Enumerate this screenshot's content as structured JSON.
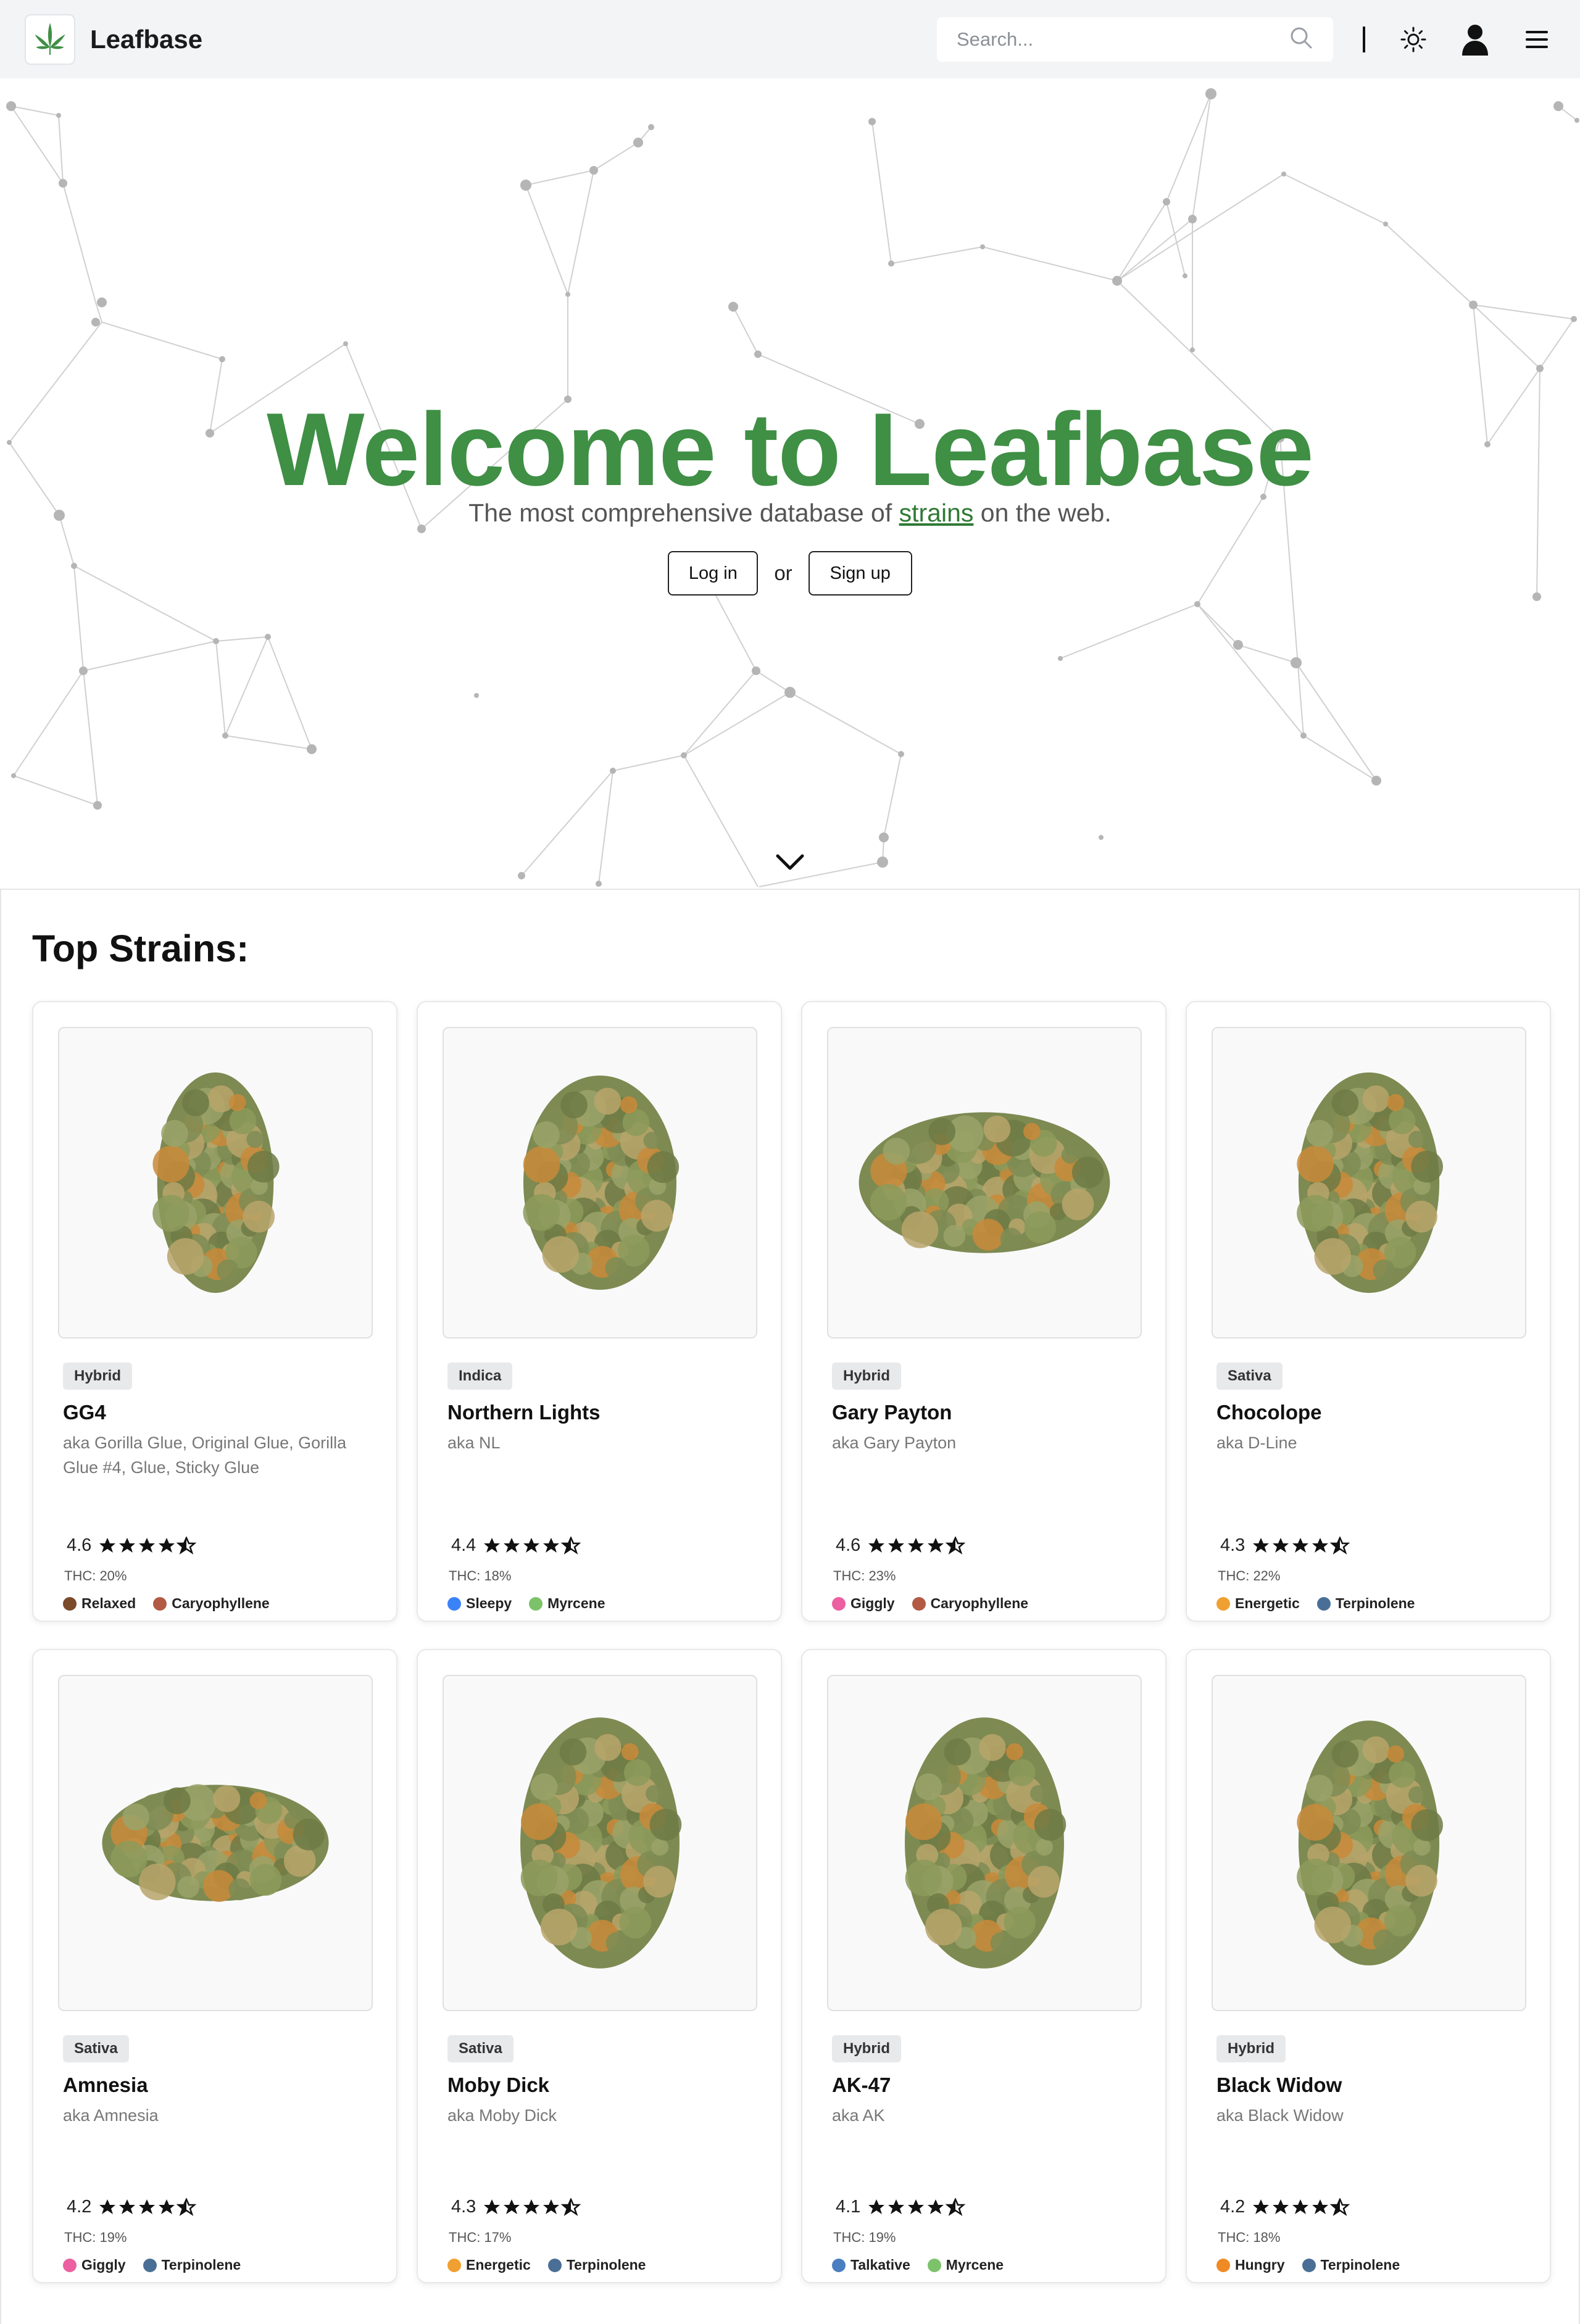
{
  "brand": {
    "name": "Leafbase",
    "accent": "#3f8f45"
  },
  "search": {
    "placeholder": "Search..."
  },
  "nav": {
    "icons": [
      "search-icon",
      "sun-icon",
      "user-icon",
      "menu-icon"
    ]
  },
  "hero": {
    "title": "Welcome to Leafbase",
    "subtitle_before": "The most comprehensive database of ",
    "subtitle_link": "strains",
    "subtitle_after": " on the web.",
    "login_label": "Log in",
    "or_label": "or",
    "signup_label": "Sign up"
  },
  "section": {
    "title": "Top Strains:"
  },
  "strains": [
    {
      "type": "Hybrid",
      "name": "GG4",
      "aka": "aka Gorilla Glue, Original Glue, Gorilla Glue #4, Glue, Sticky Glue",
      "rating": "4.6",
      "thc": "THC: 20%",
      "tags": [
        {
          "label": "Relaxed",
          "color": "#7a4a2a"
        },
        {
          "label": "Caryophyllene",
          "color": "#b25a44"
        }
      ]
    },
    {
      "type": "Indica",
      "name": "Northern Lights",
      "aka": "aka NL",
      "rating": "4.4",
      "thc": "THC: 18%",
      "tags": [
        {
          "label": "Sleepy",
          "color": "#3b82f6"
        },
        {
          "label": "Myrcene",
          "color": "#7cc26a"
        }
      ]
    },
    {
      "type": "Hybrid",
      "name": "Gary Payton",
      "aka": "aka Gary Payton",
      "rating": "4.6",
      "thc": "THC: 23%",
      "tags": [
        {
          "label": "Giggly",
          "color": "#ec5fa0"
        },
        {
          "label": "Caryophyllene",
          "color": "#b25a44"
        }
      ]
    },
    {
      "type": "Sativa",
      "name": "Chocolope",
      "aka": "aka D-Line",
      "rating": "4.3",
      "thc": "THC: 22%",
      "tags": [
        {
          "label": "Energetic",
          "color": "#f0a030"
        },
        {
          "label": "Terpinolene",
          "color": "#4a6f96"
        }
      ]
    },
    {
      "type": "Sativa",
      "name": "Amnesia",
      "aka": "aka Amnesia",
      "rating": "4.2",
      "thc": "THC: 19%",
      "tags": [
        {
          "label": "Giggly",
          "color": "#ec5fa0"
        },
        {
          "label": "Terpinolene",
          "color": "#4a6f96"
        }
      ]
    },
    {
      "type": "Sativa",
      "name": "Moby Dick",
      "aka": "aka Moby Dick",
      "rating": "4.3",
      "thc": "THC: 17%",
      "tags": [
        {
          "label": "Energetic",
          "color": "#f0a030"
        },
        {
          "label": "Terpinolene",
          "color": "#4a6f96"
        }
      ]
    },
    {
      "type": "Hybrid",
      "name": "AK-47",
      "aka": "aka AK",
      "rating": "4.1",
      "thc": "THC: 19%",
      "tags": [
        {
          "label": "Talkative",
          "color": "#4a7ec0"
        },
        {
          "label": "Myrcene",
          "color": "#7cc26a"
        }
      ]
    },
    {
      "type": "Hybrid",
      "name": "Black Widow",
      "aka": "aka Black Widow",
      "rating": "4.2",
      "thc": "THC: 18%",
      "tags": [
        {
          "label": "Hungry",
          "color": "#f08a24"
        },
        {
          "label": "Terpinolene",
          "color": "#4a6f96"
        }
      ]
    }
  ]
}
